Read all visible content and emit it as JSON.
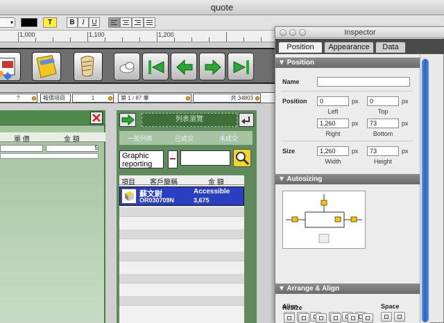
{
  "window": {
    "title": "quote"
  },
  "format_toolbar": {
    "highlight_label": "T",
    "bold_label": "B",
    "italic_label": "I",
    "underline_label": "U"
  },
  "ruler": {
    "labels": [
      "1,000",
      "1,100",
      "1,200"
    ]
  },
  "status_bar": {
    "field_1": "?",
    "field_2": "報價項目",
    "field_3": "1",
    "record_info": "第 1 / 87 筆",
    "total_info": "共 34803"
  },
  "left_panel": {
    "columns": {
      "unit_price": "單 價",
      "amount": "金 額"
    },
    "row_value": "5"
  },
  "list_panel": {
    "header_label": "列表瀏覽",
    "tabs": {
      "general_list": "一般列表",
      "closed": "已成交",
      "open": "未成交"
    },
    "graphic_field": "Graphic reporting",
    "columns": {
      "item": "項目",
      "customer": "客戶簡稱",
      "amount": "金 額"
    },
    "selected_row": {
      "customer_name": "蘇文尉",
      "quote_id": "OR030709N",
      "status": "Accessible",
      "amount": "3,675"
    }
  },
  "inspector": {
    "title": "Inspector",
    "tabs": [
      "Position",
      "Appearance",
      "Data"
    ],
    "active_tab": "Position",
    "sections": {
      "position": "Position",
      "autosizing": "Autosizing",
      "arrange": "Arrange & Align"
    },
    "name_label": "Name",
    "name_value": "",
    "position_label": "Position",
    "size_label": "Size",
    "unit": "px",
    "left_value": "0",
    "top_value": "0",
    "right_value": "1,260",
    "bottom_value": "73",
    "width_value": "1,260",
    "height_value": "73",
    "left_label": "Left",
    "top_label": "Top",
    "right_label": "Right",
    "bottom_label": "Bottom",
    "width_label": "Width",
    "height_label": "Height",
    "align_label": "Align",
    "space_label": "Space",
    "resize_label": "Resize"
  },
  "colors": {
    "text_color": "#000000",
    "highlight": "#ffef3a",
    "panel_green": "#5f8b5c",
    "selection_blue": "#2a3ec2",
    "scroll_blue": "#2a62c5"
  }
}
